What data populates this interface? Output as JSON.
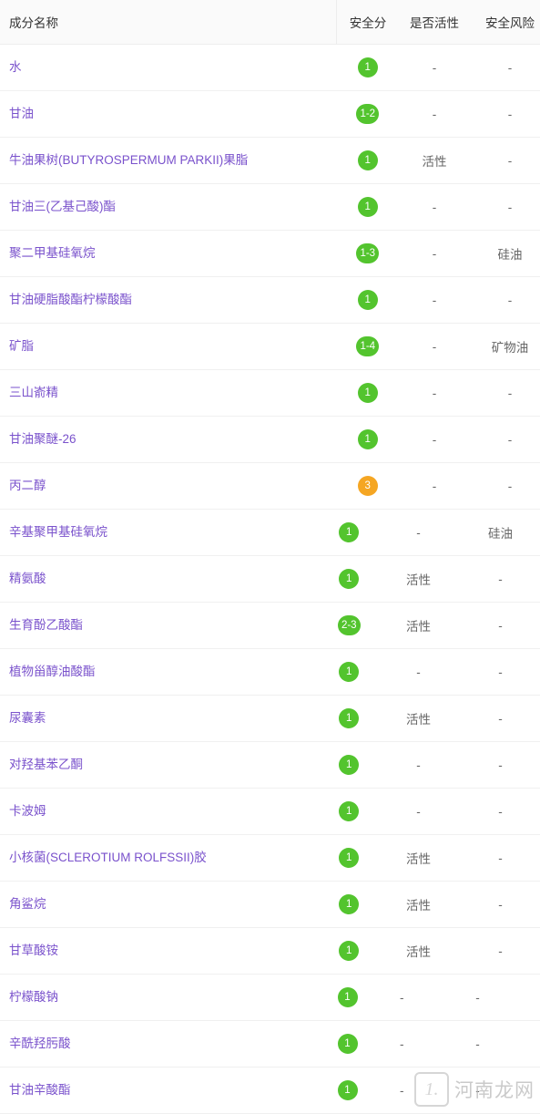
{
  "table": {
    "columns": {
      "name": "成分名称",
      "score": "安全分",
      "active": "是否活性",
      "risk": "安全风险"
    },
    "rows": [
      {
        "name": "水",
        "score": "1",
        "score_color": "green",
        "active": "-",
        "risk": "-"
      },
      {
        "name": "甘油",
        "score": "1-2",
        "score_color": "green",
        "active": "-",
        "risk": "-"
      },
      {
        "name": "牛油果树(BUTYROSPERMUM PARKII)果脂",
        "score": "1",
        "score_color": "green",
        "active": "活性",
        "risk": "-"
      },
      {
        "name": "甘油三(乙基己酸)酯",
        "score": "1",
        "score_color": "green",
        "active": "-",
        "risk": "-"
      },
      {
        "name": "聚二甲基硅氧烷",
        "score": "1-3",
        "score_color": "green",
        "active": "-",
        "risk": "硅油"
      },
      {
        "name": "甘油硬脂酸酯柠檬酸酯",
        "score": "1",
        "score_color": "green",
        "active": "-",
        "risk": "-"
      },
      {
        "name": "矿脂",
        "score": "1-4",
        "score_color": "green",
        "active": "-",
        "risk": "矿物油"
      },
      {
        "name": "三山嵛精",
        "score": "1",
        "score_color": "green",
        "active": "-",
        "risk": "-"
      },
      {
        "name": "甘油聚醚-26",
        "score": "1",
        "score_color": "green",
        "active": "-",
        "risk": "-"
      },
      {
        "name": "丙二醇",
        "score": "3",
        "score_color": "orange",
        "active": "-",
        "risk": "-"
      },
      {
        "name": "辛基聚甲基硅氧烷",
        "score": "1",
        "score_color": "green",
        "active": "-",
        "risk": "硅油"
      },
      {
        "name": "精氨酸",
        "score": "1",
        "score_color": "green",
        "active": "活性",
        "risk": "-"
      },
      {
        "name": "生育酚乙酸酯",
        "score": "2-3",
        "score_color": "green",
        "active": "活性",
        "risk": "-"
      },
      {
        "name": "植物甾醇油酸酯",
        "score": "1",
        "score_color": "green",
        "active": "-",
        "risk": "-"
      },
      {
        "name": "尿囊素",
        "score": "1",
        "score_color": "green",
        "active": "活性",
        "risk": "-"
      },
      {
        "name": "对羟基苯乙酮",
        "score": "1",
        "score_color": "green",
        "active": "-",
        "risk": "-"
      },
      {
        "name": "卡波姆",
        "score": "1",
        "score_color": "green",
        "active": "-",
        "risk": "-"
      },
      {
        "name": "小核菌(SCLEROTIUM ROLFSSII)胶",
        "score": "1",
        "score_color": "green",
        "active": "活性",
        "risk": "-"
      },
      {
        "name": "角鲨烷",
        "score": "1",
        "score_color": "green",
        "active": "活性",
        "risk": "-"
      },
      {
        "name": "甘草酸铵",
        "score": "1",
        "score_color": "green",
        "active": "活性",
        "risk": "-"
      },
      {
        "name": "柠檬酸钠",
        "score": "1",
        "score_color": "green",
        "active": "-",
        "risk": "-"
      },
      {
        "name": "辛酰羟肟酸",
        "score": "1",
        "score_color": "green",
        "active": "-",
        "risk": "-"
      },
      {
        "name": "甘油辛酸酯",
        "score": "1",
        "score_color": "green",
        "active": "-",
        "risk": "-"
      }
    ]
  },
  "watermark": {
    "logo_text": "1.",
    "text": "河南龙网"
  }
}
